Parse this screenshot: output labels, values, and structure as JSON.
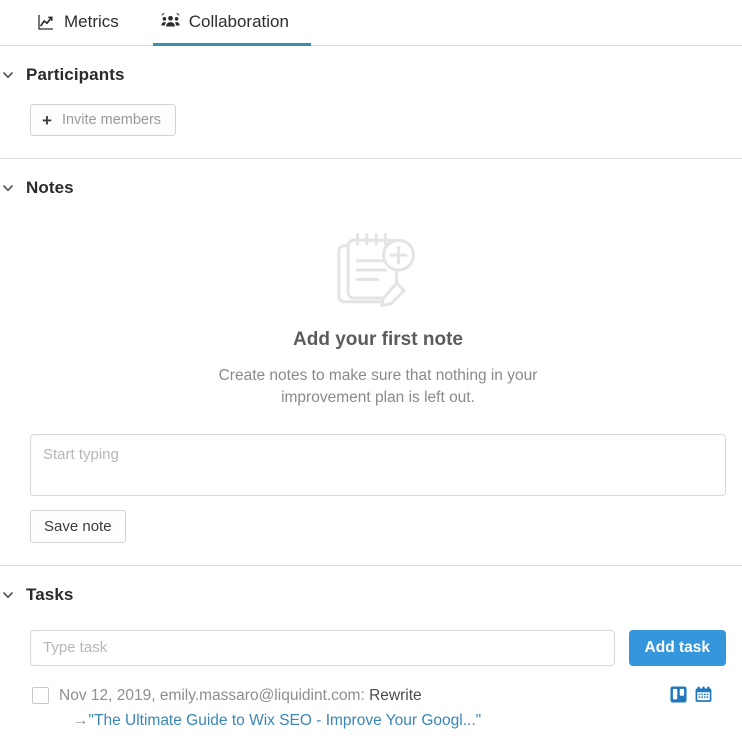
{
  "tabs": [
    {
      "label": "Metrics",
      "icon": "chart-line-icon",
      "active": false
    },
    {
      "label": "Collaboration",
      "icon": "people-group-icon",
      "active": true
    }
  ],
  "accent_color": "#3d8db3",
  "link_color": "#3a86b5",
  "button_color": "#3596dc",
  "participants": {
    "title": "Participants",
    "invite_label": "Invite members",
    "plus": "+"
  },
  "notes": {
    "title": "Notes",
    "empty_title": "Add your first note",
    "empty_subtitle": "Create notes to make sure that nothing in your improvement plan is left out.",
    "input_placeholder": "Start typing",
    "input_value": "",
    "save_label": "Save note"
  },
  "tasks": {
    "title": "Tasks",
    "input_placeholder": "Type task",
    "input_value": "",
    "add_label": "Add task",
    "items": [
      {
        "checked": false,
        "meta": "Nov 12, 2019, emily.massaro@liquidint.com: ",
        "action": "Rewrite",
        "arrow": "→",
        "link": "\"The Ultimate Guide to Wix SEO - Improve Your Googl...\"",
        "icons": [
          "trello-board-icon",
          "calendar-icon"
        ]
      }
    ]
  }
}
